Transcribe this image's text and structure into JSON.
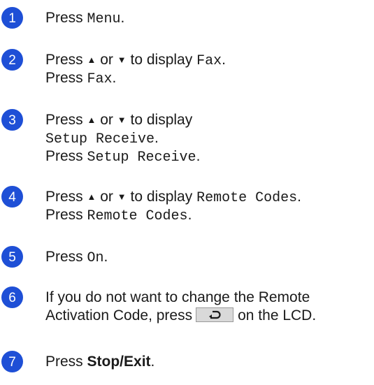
{
  "accent_color": "#1e4fd6",
  "steps": [
    {
      "number": "1",
      "press": "Press",
      "menu": "Menu",
      "dot": "."
    },
    {
      "number": "2",
      "line1_pre": "Press",
      "up": "▲",
      "or": "or",
      "down": "▼",
      "to_display": "to display",
      "fax": "Fax",
      "dot": ".",
      "line2_press": "Press",
      "line2_fax": "Fax",
      "line2_dot": "."
    },
    {
      "number": "3",
      "line1_pre": "Press",
      "up": "▲",
      "or": "or",
      "down": "▼",
      "to_display": "to display",
      "setup": "Setup Receive",
      "dot": ".",
      "line3_press": "Press",
      "line3_setup": "Setup Receive",
      "line3_dot": "."
    },
    {
      "number": "4",
      "line1_pre": "Press",
      "up": "▲",
      "or": "or",
      "down": "▼",
      "to_display": "to display",
      "remote": "Remote Codes",
      "dot": ".",
      "line2_press": "Press",
      "line2_remote": "Remote Codes",
      "line2_dot": "."
    },
    {
      "number": "5",
      "press": "Press",
      "on": "On",
      "dot": "."
    },
    {
      "number": "6",
      "line1": "If you do not want to change the Remote",
      "line2_pre": "Activation Code, press",
      "line2_post": "on the LCD.",
      "back_icon": "back-arrow-icon"
    },
    {
      "number": "7",
      "press": "Press",
      "stop": "Stop/Exit",
      "dot": "."
    }
  ]
}
